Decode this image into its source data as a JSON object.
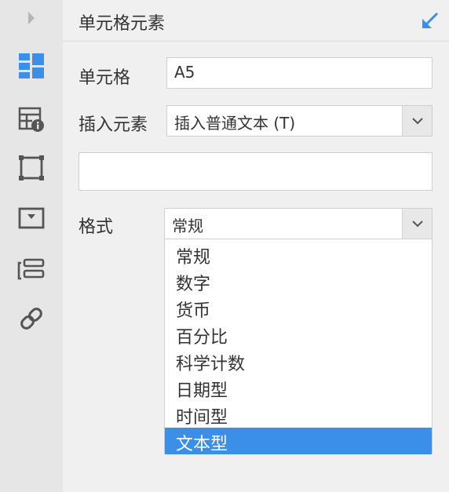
{
  "sidebar": {
    "icons": [
      "collapse-arrow-icon",
      "cell-grid-icon",
      "table-attributes-icon",
      "frame-icon",
      "widget-icon",
      "layer-icon",
      "link-icon"
    ],
    "active_color": "#3b8fe8"
  },
  "header": {
    "title": "单元格元素",
    "corner_icon": "expand-corner-icon"
  },
  "form": {
    "cell_label": "单元格",
    "cell_value": "A5",
    "insert_label": "插入元素",
    "insert_value": "插入普通文本 (T)",
    "content_value": "",
    "format_label": "格式",
    "format_value": "常规"
  },
  "dropdown": {
    "options": [
      "常规",
      "数字",
      "货币",
      "百分比",
      "科学计数",
      "日期型",
      "时间型",
      "文本型"
    ],
    "selected_index": 7
  },
  "colors": {
    "accent": "#3b8fe8",
    "sidebar_bg": "#e6e6e6",
    "panel_bg": "#f0f0f0"
  }
}
